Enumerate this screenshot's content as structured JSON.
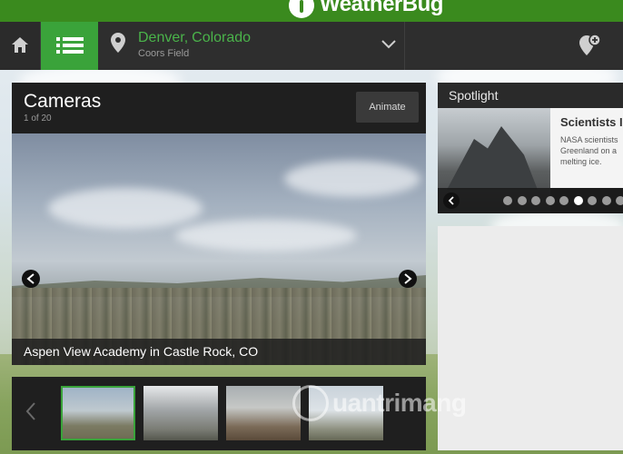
{
  "brand": {
    "name": "WeatherBug"
  },
  "nav": {
    "city": "Denver,",
    "region": "Colorado",
    "station": "Coors Field"
  },
  "cameras": {
    "title": "Cameras",
    "count": "1 of 20",
    "animate_label": "Animate",
    "caption": "Aspen View Academy in Castle Rock, CO",
    "thumbnails": 4,
    "selected_thumbnail": 1
  },
  "spotlight": {
    "title": "Spotlight",
    "headline": "Scientists I",
    "body_lines": [
      "NASA scientists",
      "Greenland on a",
      "melting ice."
    ],
    "slides": 10,
    "active_slide": 6
  },
  "watermark": {
    "text": "uantrimang"
  },
  "colors": {
    "brand_green": "#3a8a1e",
    "accent_green": "#3aa33a",
    "location_text": "#4ab34a",
    "nav_bg": "#2e2e2e"
  },
  "icons": [
    "home-icon",
    "list-icon",
    "location-pin-icon",
    "chevron-down-icon",
    "add-location-icon",
    "arrow-left-icon",
    "arrow-right-icon"
  ]
}
